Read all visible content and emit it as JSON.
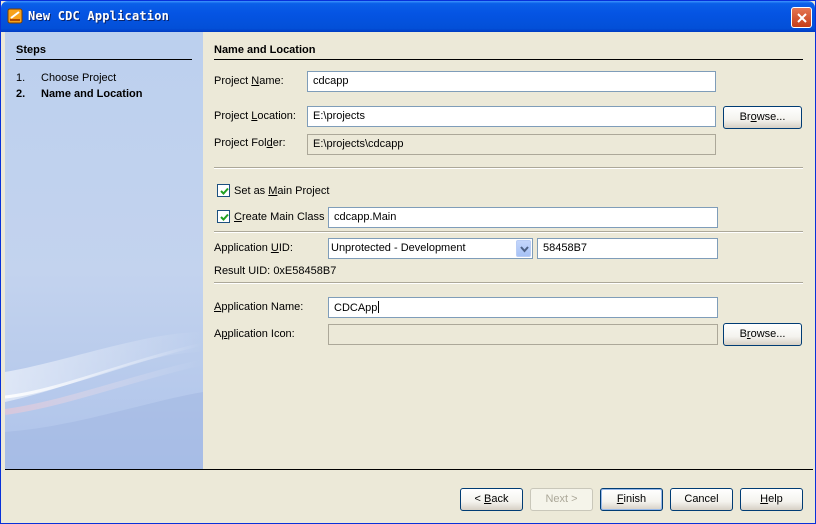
{
  "window": {
    "title": "New CDC Application",
    "accent_color": "#0554e3",
    "close_icon": "close-icon"
  },
  "steps": {
    "title": "Steps",
    "items": [
      {
        "number": "1.",
        "label": "Choose Project",
        "active": false
      },
      {
        "number": "2.",
        "label": "Name and Location",
        "active": true
      }
    ]
  },
  "main": {
    "section_title": "Name and Location",
    "project_name": {
      "label_pre": "Project ",
      "label_u": "N",
      "label_post": "ame:",
      "value": "cdcapp"
    },
    "project_location": {
      "label_pre": "Project ",
      "label_u": "L",
      "label_post": "ocation:",
      "value": "E:\\projects",
      "browse_pre": "Br",
      "browse_u": "o",
      "browse_post": "wse..."
    },
    "project_folder": {
      "label_pre": "Project Fol",
      "label_u": "d",
      "label_post": "er:",
      "value": "E:\\projects\\cdcapp"
    },
    "set_main_project": {
      "label_pre": "Set as ",
      "label_u": "M",
      "label_post": "ain Project",
      "checked": true
    },
    "create_main_class": {
      "label_pre": "",
      "label_u": "C",
      "label_post": "reate Main Class",
      "checked": true,
      "value": "cdcapp.Main"
    },
    "application_uid": {
      "label_pre": "Application ",
      "label_u": "U",
      "label_post": "ID:",
      "selected": "Unprotected - Development",
      "value": "58458B7"
    },
    "result_uid": {
      "label": "Result UID:",
      "value": "0xE58458B7"
    },
    "application_name": {
      "label_pre": "",
      "label_u": "A",
      "label_post": "pplication Name:",
      "value": "CDCApp"
    },
    "application_icon": {
      "label_pre": "A",
      "label_u": "p",
      "label_post": "plication Icon:",
      "value": "",
      "browse_pre": "B",
      "browse_u": "r",
      "browse_post": "owse..."
    }
  },
  "footer": {
    "back": {
      "pre": "< ",
      "u": "B",
      "post": "ack"
    },
    "next": "Next >",
    "finish": {
      "pre": "",
      "u": "F",
      "post": "inish"
    },
    "cancel": "Cancel",
    "help": {
      "pre": "",
      "u": "H",
      "post": "elp"
    }
  }
}
